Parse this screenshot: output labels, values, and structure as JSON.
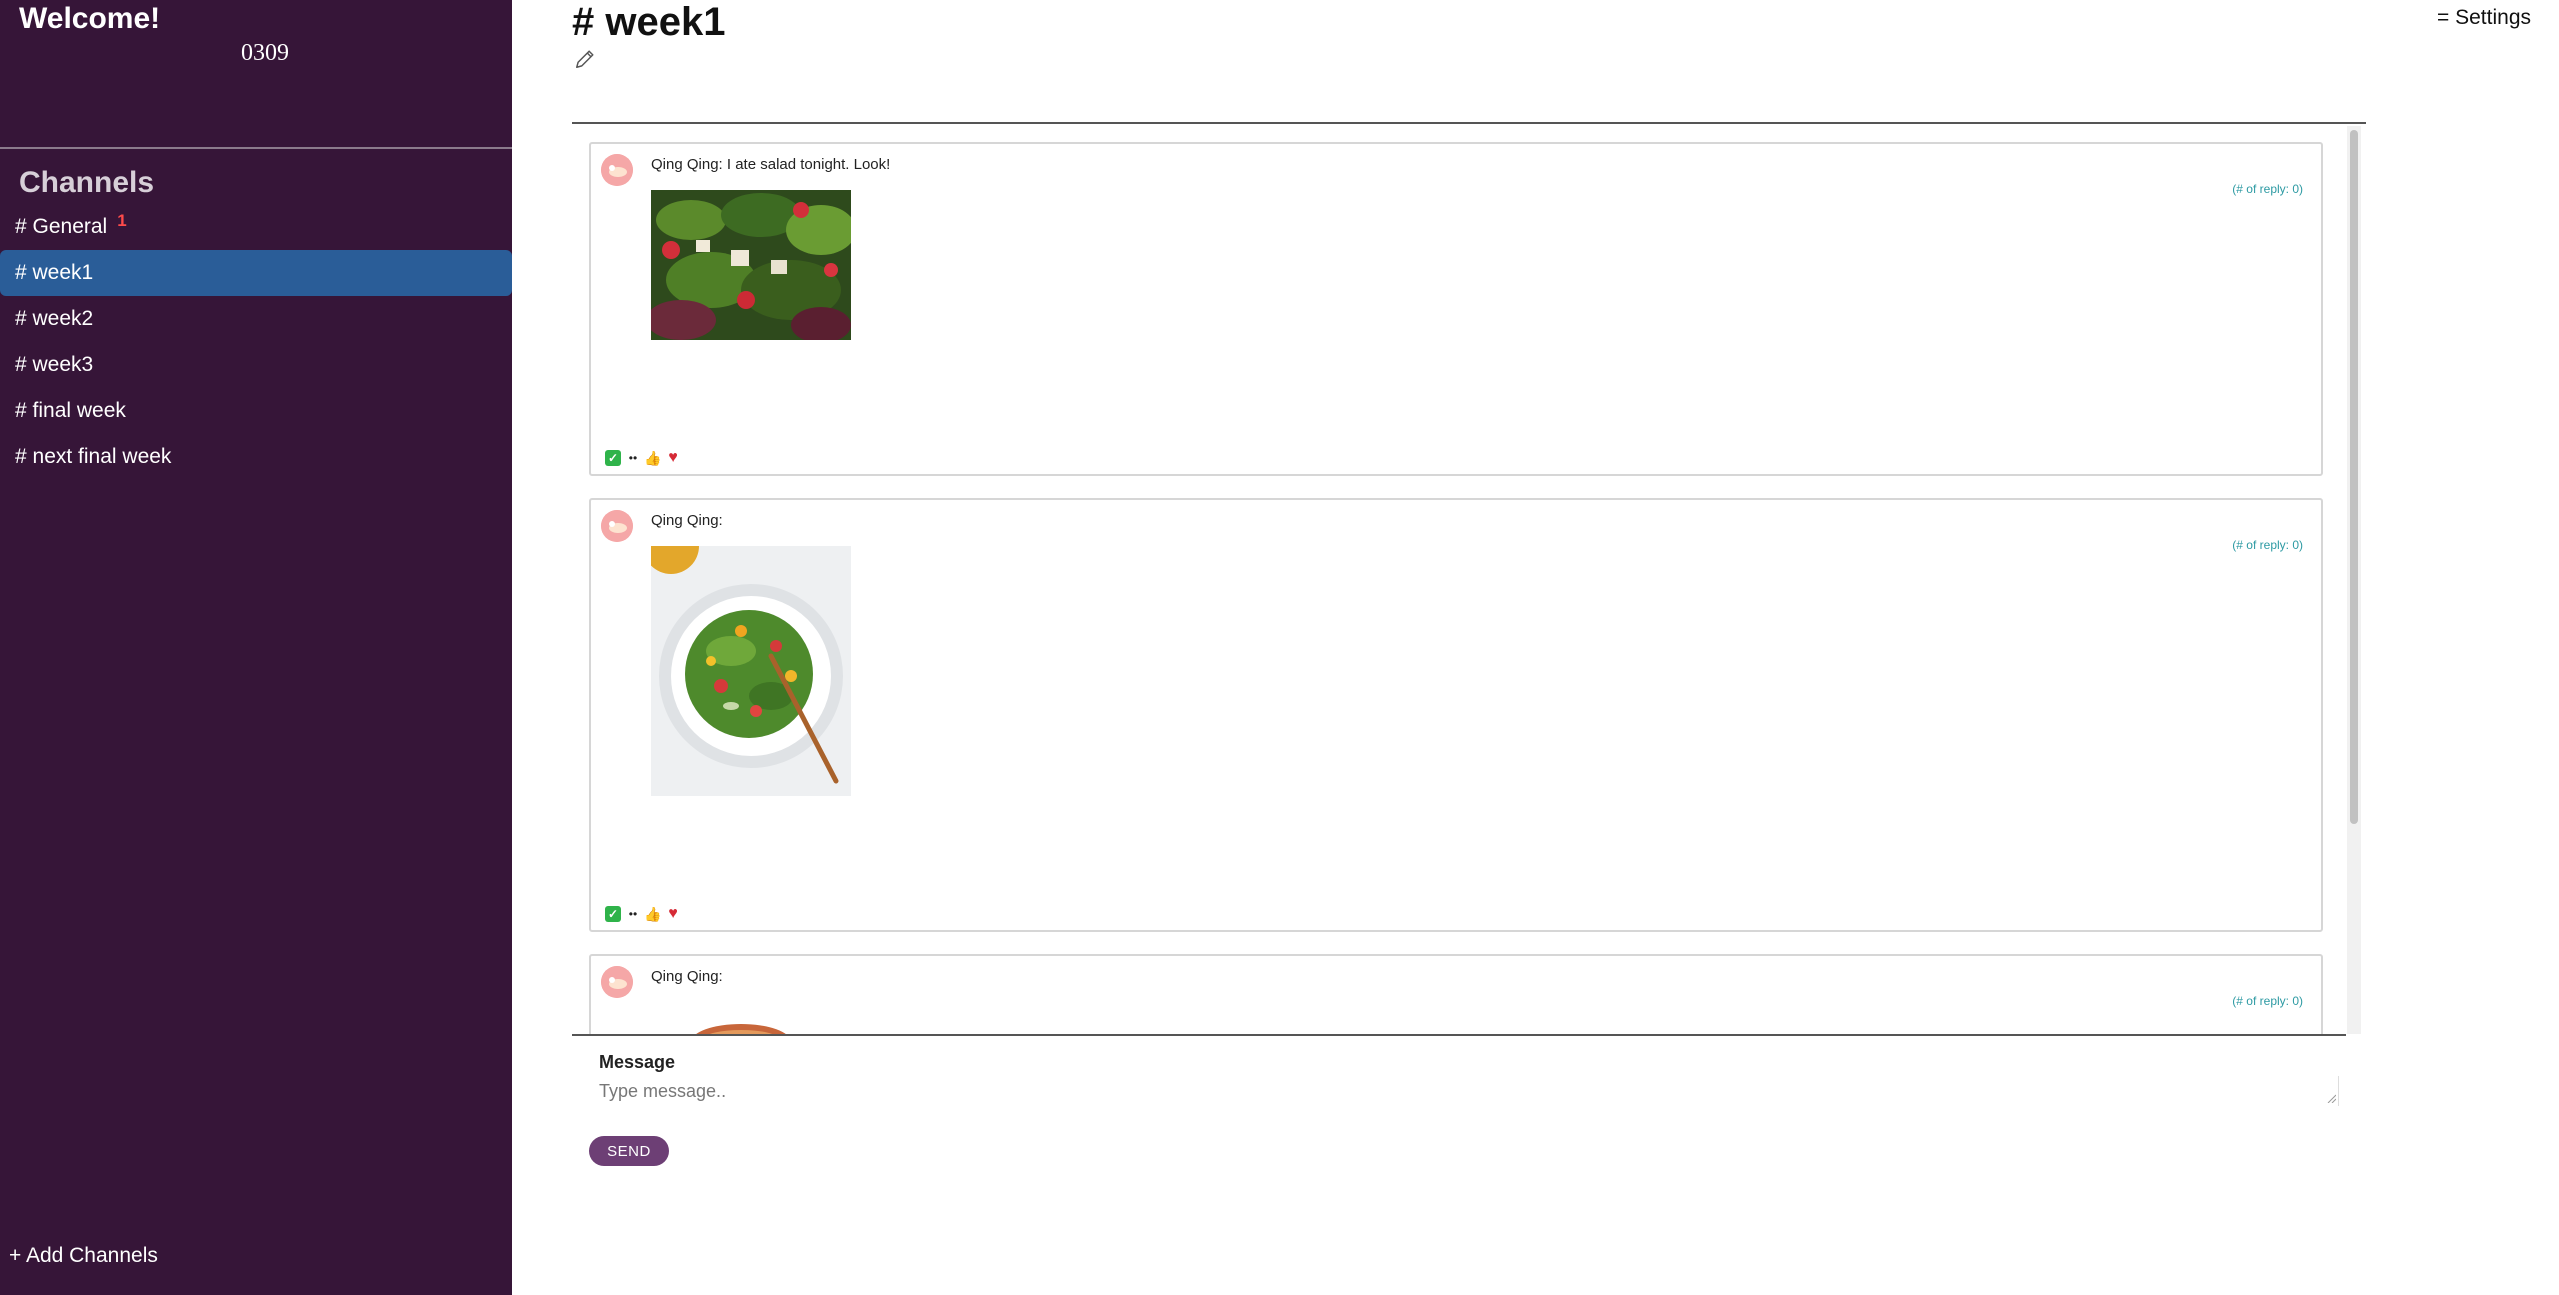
{
  "sidebar": {
    "welcome": "Welcome!",
    "user_id": "0309",
    "channels_heading": "Channels",
    "channels": [
      {
        "label": "# General",
        "unread": "1",
        "active": false
      },
      {
        "label": "# week1",
        "active": true
      },
      {
        "label": "# week2",
        "active": false
      },
      {
        "label": "# week3",
        "active": false
      },
      {
        "label": "# final week",
        "active": false
      },
      {
        "label": "# next final week",
        "active": false
      }
    ],
    "add_channels": "+ Add Channels"
  },
  "header": {
    "title": "# week1",
    "settings": "= Settings"
  },
  "messages": [
    {
      "text": "Qing Qing: I ate salad tonight. Look!",
      "reply_count": "(# of reply: 0)",
      "image": "salad-photo-1"
    },
    {
      "text": "Qing Qing:",
      "reply_count": "(# of reply: 0)",
      "image": "salad-photo-2"
    },
    {
      "text": "Qing Qing:",
      "reply_count": "(# of reply: 0)",
      "image": "food-photo-3"
    }
  ],
  "reactions": [
    "check-icon",
    "eyes-icon",
    "thumbs-up-icon",
    "heart-icon"
  ],
  "composer": {
    "label": "Message",
    "placeholder": "Type message..",
    "send": "SEND"
  },
  "colors": {
    "sidebar_bg": "#361538",
    "active_channel": "#2a5d98",
    "send_button": "#6d3f75",
    "reply_link": "#2d9aa3"
  }
}
